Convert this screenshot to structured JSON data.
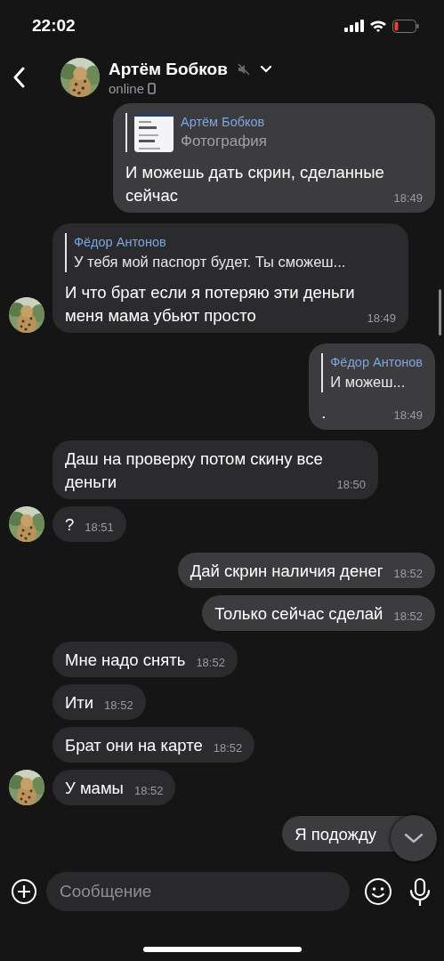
{
  "status_bar": {
    "time": "22:02",
    "battery_low": true
  },
  "header": {
    "name": "Артём Бобков",
    "muted": true,
    "status": "online"
  },
  "messages": [
    {
      "kind": "sent",
      "reply": {
        "author": "Артём Бобков",
        "text": "Фотография"
      },
      "text": "И можешь дать скрин, сделанные сейчас",
      "time": "18:49"
    },
    {
      "kind": "received",
      "avatar": true,
      "reply": {
        "author": "Фёдор Антонов",
        "text": "У тебя мой паспорт будет. Ты сможеш...",
        "kind": "text"
      },
      "text": "И что брат если я потеряю эти деньги меня мама убьют просто",
      "time": "18:49"
    },
    {
      "kind": "sent",
      "reply": {
        "author": "Фёдор Антонов",
        "text": "И можеш...",
        "kind": "text"
      },
      "text": ".",
      "time": "18:49"
    },
    {
      "kind": "received",
      "avatar": false,
      "text": "Даш на проверку потом скину все деньги",
      "time": "18:50"
    },
    {
      "kind": "received",
      "avatar": true,
      "text": "?",
      "time": "18:51"
    },
    {
      "kind": "sent",
      "text": "Дай скрин наличия денег",
      "time": "18:52"
    },
    {
      "kind": "sent",
      "text": "Только сейчас сделай",
      "time": "18:52"
    },
    {
      "kind": "received",
      "avatar": false,
      "text": "Мне надо снять",
      "time": "18:52"
    },
    {
      "kind": "received",
      "avatar": false,
      "text": "Ити",
      "time": "18:52"
    },
    {
      "kind": "received",
      "avatar": false,
      "text": "Брат они на карте",
      "time": "18:52"
    },
    {
      "kind": "received",
      "avatar": true,
      "text": "У мамы",
      "time": "18:52"
    },
    {
      "kind": "sent",
      "text": "Я подожду"
    }
  ],
  "composer": {
    "placeholder": "Сообщение"
  }
}
